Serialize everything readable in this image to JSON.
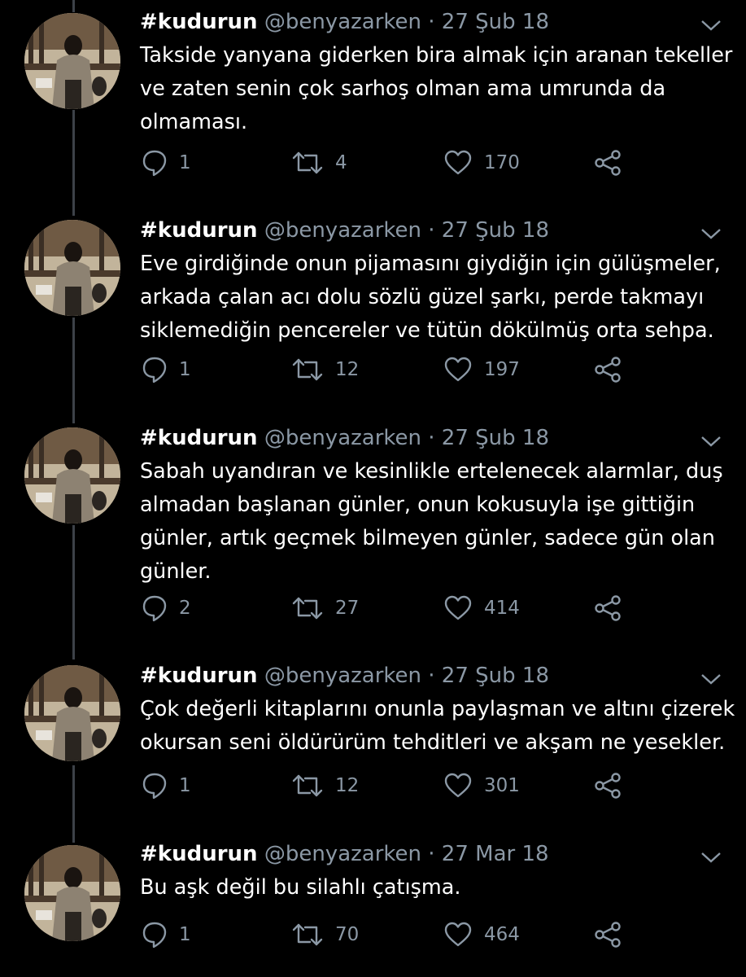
{
  "colors": {
    "background": "#000000",
    "text": "#ffffff",
    "secondary": "#8b98a5",
    "thread_line": "#3d4148"
  },
  "tweets": [
    {
      "name": "#kudurun",
      "handle": "@benyazarken",
      "separator": "·",
      "date": "27 Şub 18",
      "text": "Takside yanyana giderken bira almak için aranan tekeller ve zaten senin çok sarhoş olman ama umrunda da olmaması.",
      "replies": "1",
      "retweets": "4",
      "likes": "170"
    },
    {
      "name": "#kudurun",
      "handle": "@benyazarken",
      "separator": "·",
      "date": "27 Şub 18",
      "text": "Eve girdiğinde onun pijamasını giydiğin için gülüşmeler, arkada çalan acı dolu sözlü güzel şarkı, perde takmayı siklemediğin pencereler ve tütün dökülmüş orta sehpa.",
      "replies": "1",
      "retweets": "12",
      "likes": "197"
    },
    {
      "name": "#kudurun",
      "handle": "@benyazarken",
      "separator": "·",
      "date": "27 Şub 18",
      "text": "Sabah uyandıran ve kesinlikle ertelenecek alarmlar, duş almadan başlanan günler, onun kokusuyla işe gittiğin günler, artık geçmek bilmeyen günler, sadece gün olan günler.",
      "replies": "2",
      "retweets": "27",
      "likes": "414"
    },
    {
      "name": "#kudurun",
      "handle": "@benyazarken",
      "separator": "·",
      "date": "27 Şub 18",
      "text": "Çok değerli kitaplarını onunla paylaşman ve altını çizerek okursan seni öldürürüm tehditleri ve akşam ne yesekler.",
      "replies": "1",
      "retweets": "12",
      "likes": "301"
    },
    {
      "name": "#kudurun",
      "handle": "@benyazarken",
      "separator": "·",
      "date": "27 Mar 18",
      "text": "Bu aşk değil bu silahlı çatışma.",
      "replies": "1",
      "retweets": "70",
      "likes": "464"
    }
  ]
}
